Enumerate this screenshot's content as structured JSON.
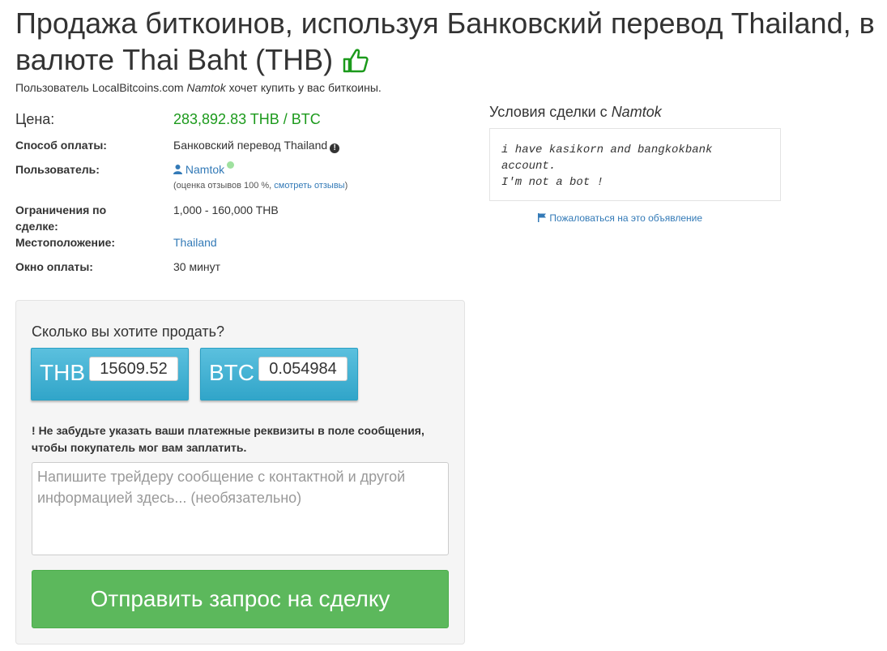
{
  "header": {
    "title": "Продажа биткоинов, используя Банковский перевод Thailand, в валюте Thai Baht (THB)",
    "subtitle_prefix": "Пользователь LocalBitcoins.com",
    "subtitle_user": "Namtok",
    "subtitle_suffix": "хочет купить у вас биткоины."
  },
  "details": {
    "price_label": "Цена:",
    "price_value": "283,892.83 THB / BTC",
    "payment_label": "Способ оплаты:",
    "payment_value": "Банковский перевод Thailand",
    "user_label": "Пользователь:",
    "user_name": "Namtok",
    "feedback_prefix": "(оценка отзывов 100 %,",
    "feedback_link": "смотреть отзывы",
    "feedback_suffix": ")",
    "limits_label": "Ограничения по сделке:",
    "limits_value": "1,000 - 160,000 THB",
    "location_label": "Местоположение:",
    "location_value": "Thailand",
    "window_label": "Окно оплаты:",
    "window_value": "30 минут"
  },
  "terms": {
    "title_prefix": "Условия сделки с",
    "title_user": "Namtok",
    "text": "i have kasikorn and bangkokbank\naccount.\nI'm not a bot !",
    "report_label": "Пожаловаться на это объявление"
  },
  "trade": {
    "question": "Сколько вы хотите продать?",
    "fiat_code": "THB",
    "fiat_amount": "15609.52",
    "btc_code": "BTC",
    "btc_amount": "0.054984",
    "warning_mark": "!",
    "warning_text": "Не забудьте указать ваши платежные реквизиты в поле сообщения, чтобы покупатель мог вам заплатить.",
    "message_placeholder": "Напишите трейдеру сообщение с контактной и другой информацией здесь... (необязательно)",
    "send_label": "Отправить запрос на сделку"
  },
  "colors": {
    "price_green": "#1c9a1c",
    "link_blue": "#337ab7",
    "currency_box": "#5bc0de",
    "send_button": "#5cb85c",
    "thumb_icon": "#1c9a1c"
  },
  "icons": [
    "thumbs-up-icon",
    "info-circle-icon",
    "user-icon",
    "online-status-icon",
    "flag-icon"
  ]
}
